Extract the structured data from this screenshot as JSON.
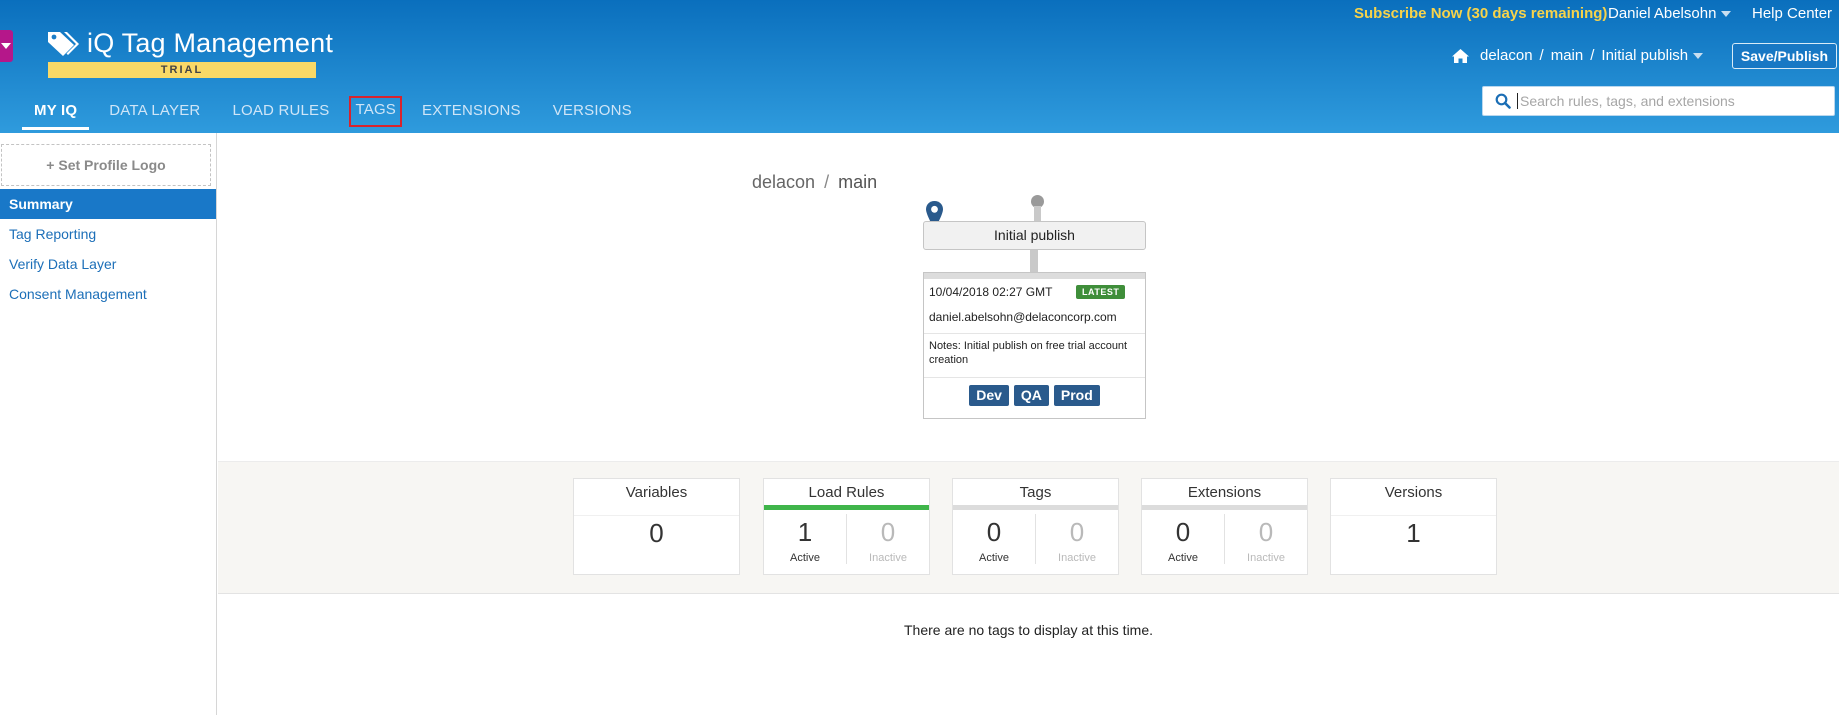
{
  "header": {
    "app_title": "iQ Tag Management",
    "trial_label": "TRIAL",
    "subscribe_text": "Subscribe Now (30 days remaining)",
    "user_name": "Daniel Abelsohn",
    "help_center": "Help Center",
    "breadcrumb": {
      "account": "delacon",
      "profile": "main",
      "version": "Initial publish"
    },
    "save_publish": "Save/Publish",
    "search_placeholder": "Search rules, tags, and extensions",
    "accent_color": "#1878c4",
    "subscribe_color": "#f7d34a"
  },
  "nav": {
    "tabs": [
      {
        "label": "MY IQ",
        "active": true
      },
      {
        "label": "DATA LAYER"
      },
      {
        "label": "LOAD RULES"
      },
      {
        "label": "TAGS",
        "highlighted": true
      },
      {
        "label": "EXTENSIONS"
      },
      {
        "label": "VERSIONS"
      }
    ]
  },
  "sidebar": {
    "set_logo": "+ Set Profile Logo",
    "items": [
      {
        "label": "Summary",
        "active": true
      },
      {
        "label": "Tag Reporting"
      },
      {
        "label": "Verify Data Layer"
      },
      {
        "label": "Consent Management"
      }
    ]
  },
  "version_panel": {
    "account": "delacon",
    "profile": "main",
    "version_name": "Initial publish",
    "date": "10/04/2018 02:27 GMT",
    "latest_badge": "LATEST",
    "email": "daniel.abelsohn@delaconcorp.com",
    "notes": "Notes: Initial publish on free trial account creation",
    "environments": [
      "Dev",
      "QA",
      "Prod"
    ]
  },
  "stats": {
    "variables": {
      "title": "Variables",
      "value": "0"
    },
    "load_rules": {
      "title": "Load Rules",
      "active": "1",
      "inactive": "0",
      "active_label": "Active",
      "inactive_label": "Inactive"
    },
    "tags": {
      "title": "Tags",
      "active": "0",
      "inactive": "0",
      "active_label": "Active",
      "inactive_label": "Inactive"
    },
    "extensions": {
      "title": "Extensions",
      "active": "0",
      "inactive": "0",
      "active_label": "Active",
      "inactive_label": "Inactive"
    },
    "versions": {
      "title": "Versions",
      "value": "1"
    }
  },
  "empty_message": "There are no tags to display at this time."
}
